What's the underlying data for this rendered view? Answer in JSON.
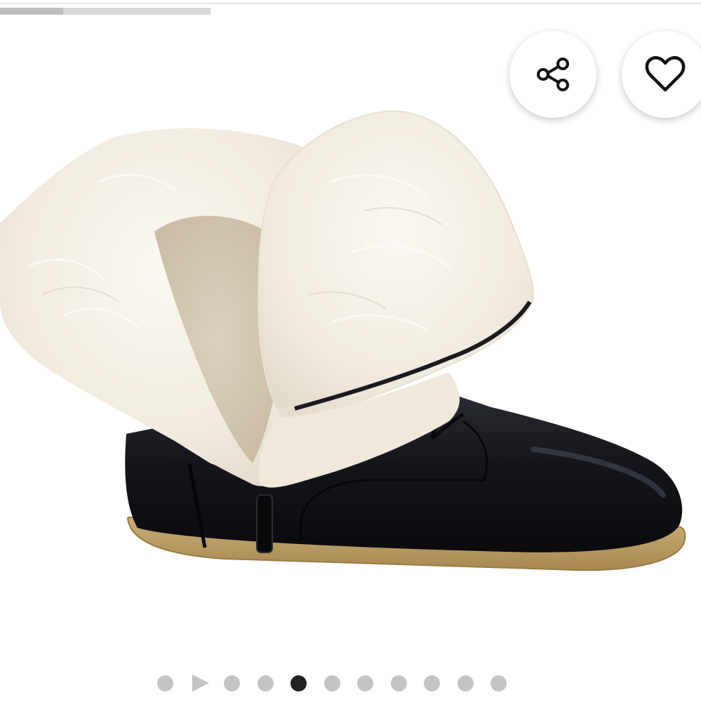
{
  "gallery": {
    "progress_fraction": 0.3,
    "total_slides": 11,
    "active_slide_index": 4,
    "play_slide_index": 1,
    "dot_color": "#c4c4c4",
    "active_dot_color": "#222222"
  },
  "actions": {
    "share_icon": "share-icon",
    "favorite_icon": "heart-icon"
  },
  "product_image": {
    "colors": {
      "leather": "#15161a",
      "fur": "#f3ede2",
      "sole": "#b89a63"
    }
  }
}
